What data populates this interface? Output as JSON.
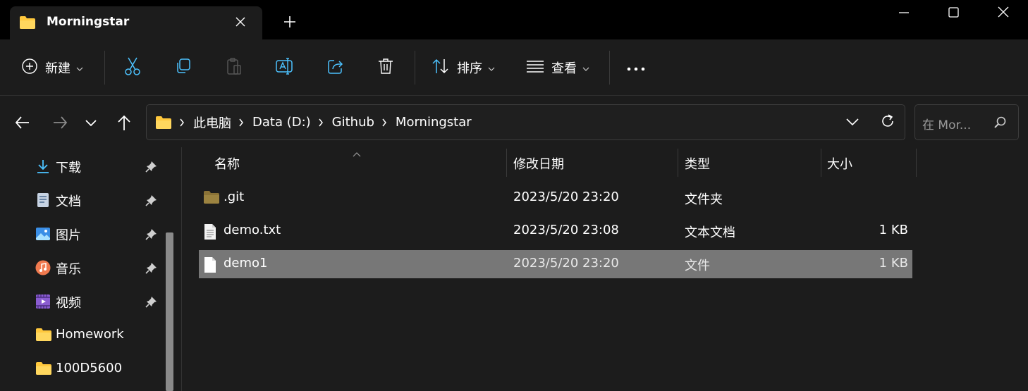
{
  "window": {
    "tab_title": "Morningstar"
  },
  "toolbar": {
    "new_label": "新建",
    "sort_label": "排序",
    "view_label": "查看"
  },
  "address": {
    "crumbs": [
      "此电脑",
      "Data (D:)",
      "Github",
      "Morningstar"
    ],
    "search_placeholder": "在 Mor..."
  },
  "sidebar": {
    "items": [
      {
        "label": "下载",
        "icon": "download-icon",
        "pinned": true
      },
      {
        "label": "文档",
        "icon": "documents-icon",
        "pinned": true
      },
      {
        "label": "图片",
        "icon": "pictures-icon",
        "pinned": true
      },
      {
        "label": "音乐",
        "icon": "music-icon",
        "pinned": true
      },
      {
        "label": "视频",
        "icon": "videos-icon",
        "pinned": true
      },
      {
        "label": "Homework",
        "icon": "folder-icon",
        "pinned": false
      },
      {
        "label": "100D5600",
        "icon": "folder-icon",
        "pinned": false
      }
    ]
  },
  "file_list": {
    "columns": {
      "name": "名称",
      "modified": "修改日期",
      "type": "类型",
      "size": "大小"
    },
    "rows": [
      {
        "name": ".git",
        "modified": "2023/5/20 23:20",
        "type": "文件夹",
        "size": "",
        "icon": "folder-icon",
        "selected": false
      },
      {
        "name": "demo.txt",
        "modified": "2023/5/20 23:08",
        "type": "文本文档",
        "size": "1 KB",
        "icon": "text-file-icon",
        "selected": false
      },
      {
        "name": "demo1",
        "modified": "2023/5/20 23:20",
        "type": "文件",
        "size": "1 KB",
        "icon": "file-icon",
        "selected": true
      }
    ]
  },
  "colors": {
    "background": "#1c1c1c",
    "titlebar": "#000000",
    "accent": "#4cc2ff",
    "folder": "#ffc83d",
    "selection": "#777777"
  }
}
